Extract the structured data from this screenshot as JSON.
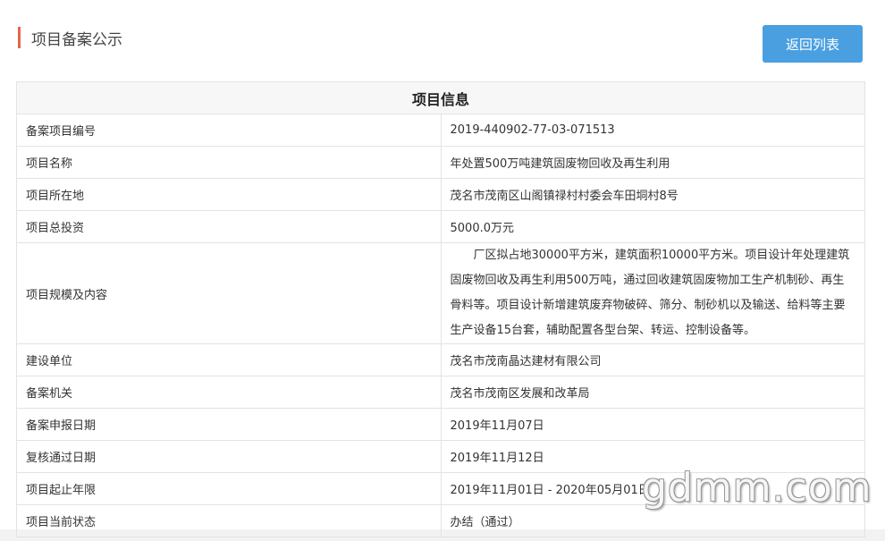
{
  "header": {
    "title": "项目备案公示",
    "back_button": "返回列表"
  },
  "table": {
    "heading": "项目信息",
    "rows": [
      {
        "label": "备案项目编号",
        "value": "2019-440902-77-03-071513"
      },
      {
        "label": "项目名称",
        "value": "年处置500万吨建筑固废物回收及再生利用"
      },
      {
        "label": "项目所在地",
        "value": "茂名市茂南区山阁镇禄村村委会车田垌村8号"
      },
      {
        "label": "项目总投资",
        "value": "5000.0万元"
      },
      {
        "label": "项目规模及内容",
        "value": "厂区拟占地30000平方米，建筑面积10000平方米。项目设计年处理建筑固废物回收及再生利用500万吨，通过回收建筑固废物加工生产机制砂、再生骨料等。项目设计新增建筑废弃物破碎、筛分、制砂机以及输送、给料等主要生产设备15台套，辅助配置各型台架、转运、控制设备等。"
      },
      {
        "label": "建设单位",
        "value": "茂名市茂南晶达建材有限公司"
      },
      {
        "label": "备案机关",
        "value": "茂名市茂南区发展和改革局"
      },
      {
        "label": "备案申报日期",
        "value": "2019年11月07日"
      },
      {
        "label": "复核通过日期",
        "value": "2019年11月12日"
      },
      {
        "label": "项目起止年限",
        "value": "2019年11月01日 - 2020年05月01日"
      },
      {
        "label": "项目当前状态",
        "value": "办结（通过）"
      }
    ]
  },
  "watermark": "gdmm.com",
  "colors": {
    "accent_bar": "#e2674a",
    "button": "#4a9fe0"
  }
}
